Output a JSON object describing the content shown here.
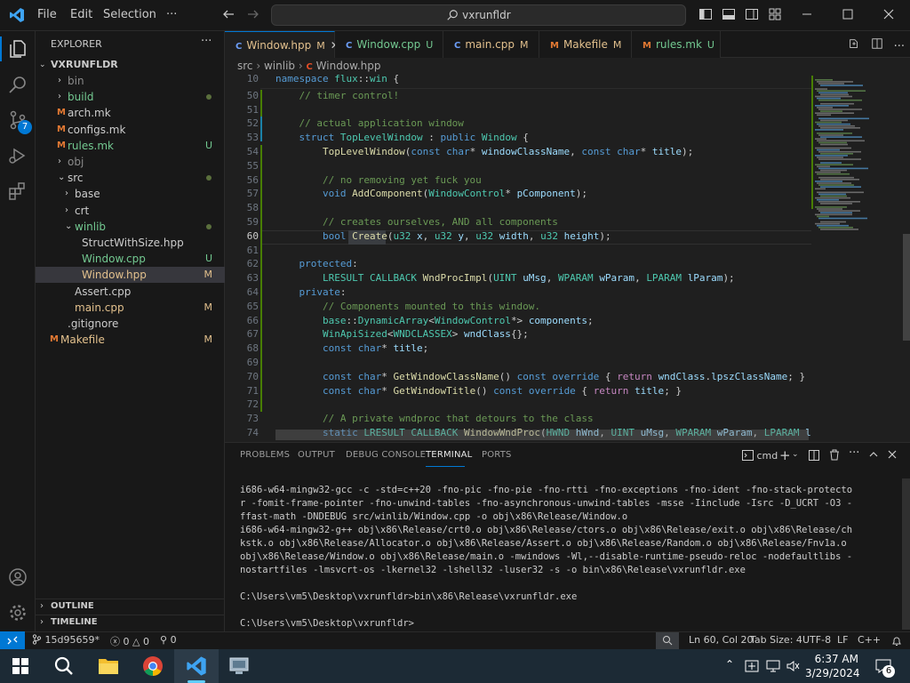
{
  "titlebar": {
    "menu": [
      "File",
      "Edit",
      "Selection",
      "···"
    ],
    "search": "vxrunfldr"
  },
  "activity": [
    "files-icon",
    "search-icon",
    "source-control-icon",
    "run-debug-icon",
    "extensions-icon"
  ],
  "activity_badge": "7",
  "sidebar": {
    "title": "EXPLORER",
    "root": "VXRUNFLDR",
    "items": [
      {
        "label": "bin",
        "indent": 1,
        "type": "folder",
        "open": false,
        "color": "#8b8b8b",
        "status": ""
      },
      {
        "label": "build",
        "indent": 1,
        "type": "folder",
        "open": false,
        "color": "#73c991",
        "status": "dot"
      },
      {
        "label": "arch.mk",
        "indent": 1,
        "type": "file",
        "color": "#ccc",
        "status": ""
      },
      {
        "label": "configs.mk",
        "indent": 1,
        "type": "file",
        "color": "#ccc",
        "status": ""
      },
      {
        "label": "rules.mk",
        "indent": 1,
        "type": "file",
        "color": "#73c991",
        "status": "U"
      },
      {
        "label": "obj",
        "indent": 1,
        "type": "folder",
        "open": false,
        "color": "#8b8b8b",
        "status": ""
      },
      {
        "label": "src",
        "indent": 1,
        "type": "folder",
        "open": true,
        "color": "#ccc",
        "status": "dot"
      },
      {
        "label": "base",
        "indent": 2,
        "type": "folder",
        "open": false,
        "color": "#ccc",
        "status": ""
      },
      {
        "label": "crt",
        "indent": 2,
        "type": "folder",
        "open": false,
        "color": "#ccc",
        "status": ""
      },
      {
        "label": "winlib",
        "indent": 2,
        "type": "folder",
        "open": true,
        "color": "#73c991",
        "status": "dot"
      },
      {
        "label": "StructWithSize.hpp",
        "indent": 3,
        "type": "file",
        "color": "#ccc",
        "status": ""
      },
      {
        "label": "Window.cpp",
        "indent": 3,
        "type": "file",
        "color": "#73c991",
        "status": "U"
      },
      {
        "label": "Window.hpp",
        "indent": 3,
        "type": "file",
        "color": "#e2c08d",
        "status": "M",
        "selected": true
      },
      {
        "label": "Assert.cpp",
        "indent": 2,
        "type": "file",
        "color": "#ccc",
        "status": ""
      },
      {
        "label": "main.cpp",
        "indent": 2,
        "type": "file",
        "color": "#e2c08d",
        "status": "M"
      },
      {
        "label": ".gitignore",
        "indent": 1,
        "type": "file",
        "color": "#ccc",
        "status": ""
      },
      {
        "label": "Makefile",
        "indent": 0,
        "type": "file",
        "color": "#e2c08d",
        "status": "M"
      }
    ],
    "outline": "OUTLINE",
    "timeline": "TIMELINE"
  },
  "tabs": [
    {
      "label": "Window.hpp",
      "status": "M",
      "active": true,
      "color": "#e2c08d"
    },
    {
      "label": "Window.cpp",
      "status": "U",
      "color": "#73c991"
    },
    {
      "label": "main.cpp",
      "status": "M",
      "color": "#e2c08d"
    },
    {
      "label": "Makefile",
      "status": "M",
      "color": "#e2c08d"
    },
    {
      "label": "rules.mk",
      "status": "U",
      "color": "#73c991"
    }
  ],
  "breadcrumb": [
    "src",
    "winlib",
    "Window.hpp"
  ],
  "editor": {
    "lines": [
      {
        "n": "10",
        "h": "<span class='k'>namespace</span> <span class='t'>flux</span>::<span class='t'>win</span> {"
      },
      {
        "n": "50",
        "h": "    <span class='c'>// timer control!</span>"
      },
      {
        "n": "51",
        "h": ""
      },
      {
        "n": "52",
        "h": "    <span class='c'>// actual application window</span>"
      },
      {
        "n": "53",
        "h": "    <span class='k'>struct</span> <span class='t'>TopLevelWindow</span> : <span class='k'>public</span> <span class='t'>Window</span> {"
      },
      {
        "n": "54",
        "h": "        <span class='f'>TopLevelWindow</span>(<span class='k'>const</span> <span class='k'>char</span>* <span class='v'>windowClassName</span>, <span class='k'>const</span> <span class='k'>char</span>* <span class='v'>title</span>);"
      },
      {
        "n": "55",
        "h": ""
      },
      {
        "n": "56",
        "h": "        <span class='c'>// no removing yet fuck you</span>"
      },
      {
        "n": "57",
        "h": "        <span class='k'>void</span> <span class='f'>AddComponent</span>(<span class='t'>WindowControl</span>* <span class='v'>pComponent</span>);"
      },
      {
        "n": "58",
        "h": ""
      },
      {
        "n": "59",
        "h": "        <span class='c'>// creates ourselves, AND all components</span>"
      },
      {
        "n": "60",
        "h": "        <span class='k'>bool</span> <span class='f'>Create</span>(<span class='t'>u32</span> <span class='v'>x</span>, <span class='t'>u32</span> <span class='v'>y</span>, <span class='t'>u32</span> <span class='v'>width</span>, <span class='t'>u32</span> <span class='v'>height</span>);"
      },
      {
        "n": "61",
        "h": ""
      },
      {
        "n": "62",
        "h": "    <span class='k'>protected</span>:"
      },
      {
        "n": "63",
        "h": "        <span class='t'>LRESULT</span> <span class='t'>CALLBACK</span> <span class='f'>WndProcImpl</span>(<span class='t'>UINT</span> <span class='v'>uMsg</span>, <span class='t'>WPARAM</span> <span class='v'>wParam</span>, <span class='t'>LPARAM</span> <span class='v'>lParam</span>);"
      },
      {
        "n": "64",
        "h": "    <span class='k'>private</span>:"
      },
      {
        "n": "65",
        "h": "        <span class='c'>// Components mounted to this window.</span>"
      },
      {
        "n": "66",
        "h": "        <span class='t'>base</span>::<span class='t'>DynamicArray</span>&lt;<span class='t'>WindowControl</span>*&gt; <span class='v'>components</span>;"
      },
      {
        "n": "67",
        "h": "        <span class='t'>WinApiSized</span>&lt;<span class='t'>WNDCLASSEX</span>&gt; <span class='v'>wndClass</span>{};"
      },
      {
        "n": "68",
        "h": "        <span class='k'>const</span> <span class='k'>char</span>* <span class='v'>title</span>;"
      },
      {
        "n": "69",
        "h": ""
      },
      {
        "n": "70",
        "h": "        <span class='k'>const</span> <span class='k'>char</span>* <span class='f'>GetWindowClassName</span>() <span class='k'>const</span> <span class='k'>override</span> { <span class='p'>return</span> <span class='v'>wndClass</span>.<span class='v'>lpszClassName</span>; }"
      },
      {
        "n": "71",
        "h": "        <span class='k'>const</span> <span class='k'>char</span>* <span class='f'>GetWindowTitle</span>() <span class='k'>const</span> <span class='k'>override</span> { <span class='p'>return</span> <span class='v'>title</span>; }"
      },
      {
        "n": "72",
        "h": ""
      },
      {
        "n": "73",
        "h": "        <span class='c'>// A private wndproc that detours to the class</span>"
      },
      {
        "n": "74",
        "h": "        <span class='k'>static</span> <span class='t'>LRESULT</span> <span class='t'>CALLBACK</span> <span class='f'>WindowWndProc</span>(<span class='t'>HWND</span> <span class='v'>hWnd</span>, <span class='t'>UINT</span> <span class='v'>uMsg</span>, <span class='t'>WPARAM</span> <span class='v'>wParam</span>, <span class='t'>LPARAM</span> <span class='v'>lPar</span>"
      }
    ]
  },
  "panel": {
    "tabs": [
      "PROBLEMS",
      "OUTPUT",
      "DEBUG CONSOLE",
      "TERMINAL",
      "PORTS"
    ],
    "active": "TERMINAL",
    "shell": "cmd",
    "terminal": "i686-w64-mingw32-gcc -c -std=c++20 -fno-pic -fno-pie -fno-rtti -fno-exceptions -fno-ident -fno-stack-protector -fomit-frame-pointer -fno-unwind-tables -fno-asynchronous-unwind-tables -msse -Iinclude -Isrc -D_UCRT -O3 -ffast-math -DNDEBUG src/winlib/Window.cpp -o obj\\x86\\Release/Window.o\ni686-w64-mingw32-g++ obj\\x86\\Release/crt0.o obj\\x86\\Release/ctors.o obj\\x86\\Release/exit.o obj\\x86\\Release/chkstk.o obj\\x86\\Release/Allocator.o obj\\x86\\Release/Assert.o obj\\x86\\Release/Random.o obj\\x86\\Release/Fnv1a.o obj\\x86\\Release/Window.o obj\\x86\\Release/main.o -mwindows -Wl,--disable-runtime-pseudo-reloc -nodefaultlibs -nostartfiles -lmsvcrt-os -lkernel32 -lshell32 -luser32 -s -o bin\\x86\\Release\\vxrunfldr.exe\n\nC:\\Users\\vm5\\Desktop\\vxrunfldr>bin\\x86\\Release\\vxrunfldr.exe\n\nC:\\Users\\vm5\\Desktop\\vxrunfldr>"
  },
  "status": {
    "branch": "15d95659*",
    "errors": "0",
    "warnings": "0",
    "ports": "0",
    "position": "Ln 60, Col 20",
    "tabsize": "Tab Size: 4",
    "encoding": "UTF-8",
    "eol": "LF",
    "lang": "C++"
  },
  "taskbar": {
    "time": "6:37 AM",
    "date": "3/29/2024",
    "notif": "6"
  },
  "colors": {
    "accent": "#0078d4",
    "modified": "#e2c08d",
    "untracked": "#73c991"
  }
}
